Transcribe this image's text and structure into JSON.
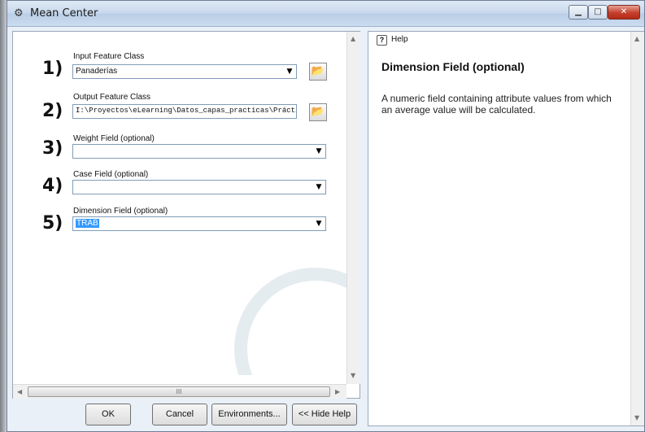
{
  "window": {
    "title": "Mean Center",
    "app_icon": "toolbox-icon"
  },
  "params": [
    {
      "number": "1)",
      "label": "Input Feature Class",
      "value": "Panaderías"
    },
    {
      "number": "2)",
      "label": "Output Feature Class",
      "value": "I:\\Proyectos\\eLearning\\Datos_capas_practicas\\Prácticas\\C"
    },
    {
      "number": "3)",
      "label": "Weight Field (optional)",
      "value": ""
    },
    {
      "number": "4)",
      "label": "Case Field (optional)",
      "value": ""
    },
    {
      "number": "5)",
      "label": "Dimension Field (optional)",
      "value": "TRAB"
    }
  ],
  "buttons": {
    "ok": "OK",
    "cancel": "Cancel",
    "environments": "Environments...",
    "hide_help": "<< Hide Help"
  },
  "help": {
    "tab_label": "Help",
    "title": "Dimension Field (optional)",
    "body": "A numeric field containing attribute values from which an average value will be calculated."
  },
  "scroll_thumb_glyph": "III"
}
